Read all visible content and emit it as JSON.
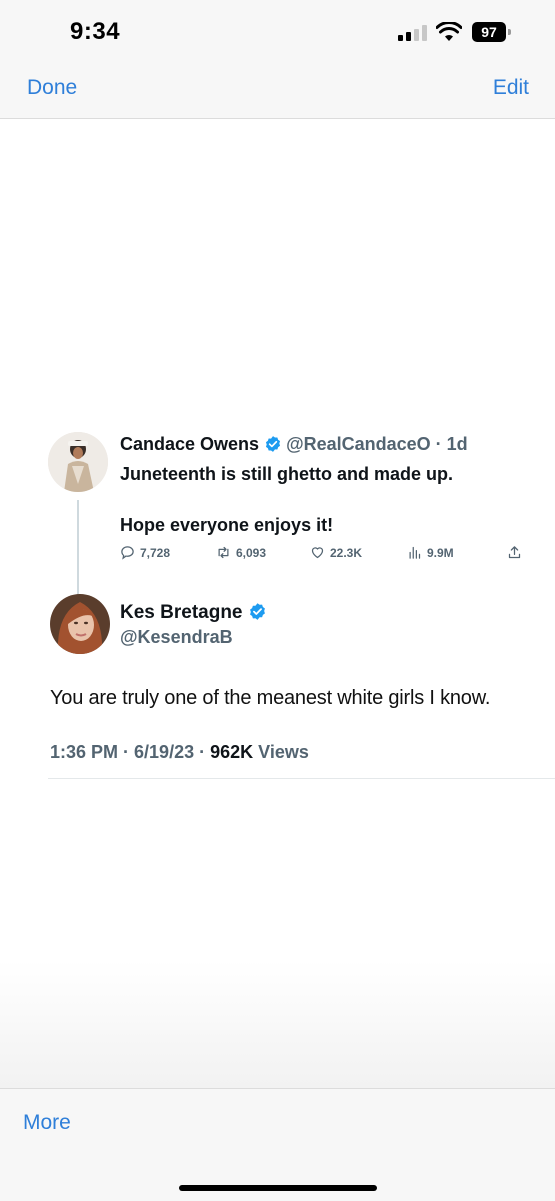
{
  "status_bar": {
    "time": "9:34",
    "battery_level": "97",
    "signal_bars_filled": 2,
    "signal_bars_total": 4,
    "icons": [
      "cellular-signal-icon",
      "wifi-icon",
      "battery-icon"
    ]
  },
  "nav": {
    "done_label": "Done",
    "edit_label": "Edit"
  },
  "quoted_tweet": {
    "name": "Candace Owens",
    "handle": "@RealCandaceO",
    "separator": " · ",
    "age": "1d",
    "text_line1": "Juneteenth is still ghetto and made up.",
    "text_line2": "Hope everyone enjoys it!",
    "replies": "7,728",
    "retweets": "6,093",
    "likes": "22.3K",
    "views": "9.9M",
    "icons": [
      "verified-badge-icon",
      "reply-icon",
      "retweet-icon",
      "like-icon",
      "views-icon",
      "share-icon"
    ]
  },
  "tweet": {
    "name": "Kes Bretagne",
    "handle": "@KesendraB",
    "text": "You are truly one of the meanest white girls I know.",
    "time": "1:36 PM",
    "date": "6/19/23",
    "separator": " · ",
    "views_count": "962K",
    "views_label": "Views"
  },
  "toolbar": {
    "more_label": "More"
  },
  "colors": {
    "ios_blue": "#2f7fd9",
    "verified_blue": "#1d9bf0",
    "secondary_text": "#536471",
    "primary_text": "#0f1419"
  }
}
